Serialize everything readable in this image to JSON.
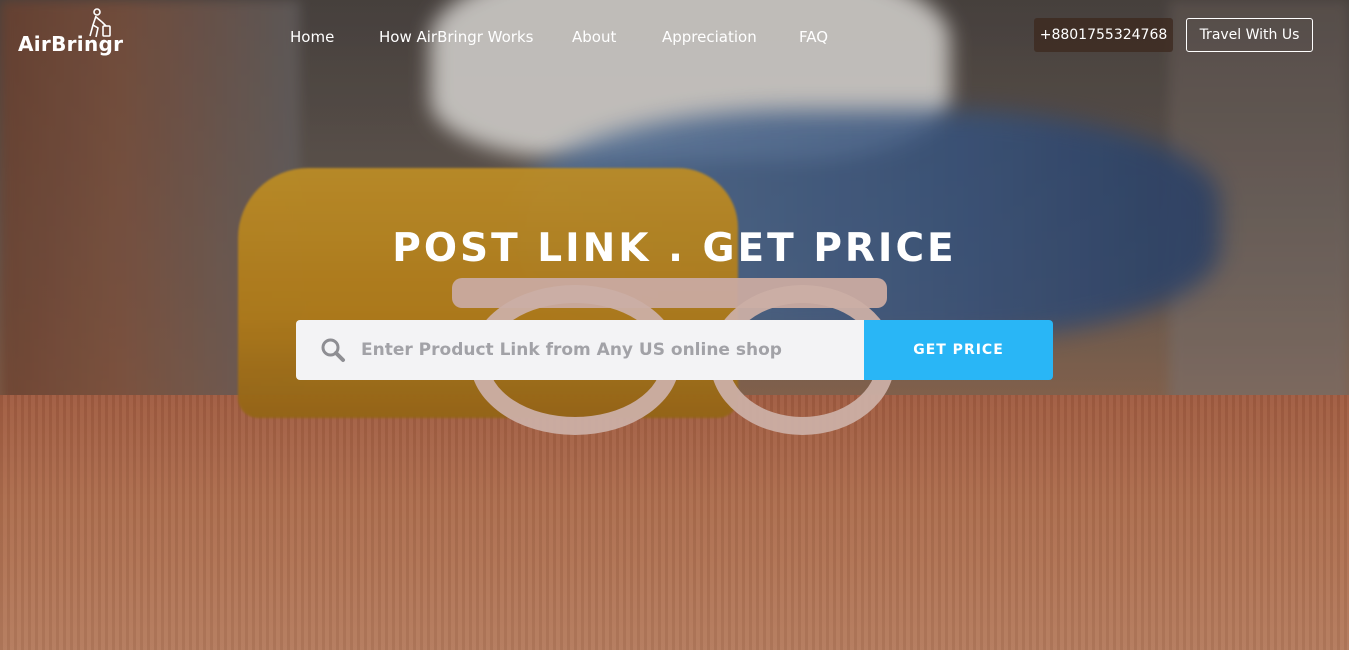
{
  "brand": {
    "name": "AirBringr",
    "icon": "traveler-with-suitcase-icon"
  },
  "nav": {
    "items": [
      {
        "label": "Home"
      },
      {
        "label": "How AirBringr Works"
      },
      {
        "label": "About"
      },
      {
        "label": "Appreciation"
      },
      {
        "label": "FAQ"
      }
    ]
  },
  "header": {
    "phone_label": "+8801755324768",
    "travel_label": "Travel With Us"
  },
  "hero": {
    "headline": "POST LINK . GET PRICE",
    "search": {
      "icon": "search-icon",
      "placeholder": "Enter Product Link from Any US online shop",
      "value": ""
    },
    "cta_label": "GET PRICE"
  },
  "colors": {
    "accent": "#29b6f6",
    "search_bg": "#f3f3f5",
    "phone_bg": "#3c281e"
  }
}
